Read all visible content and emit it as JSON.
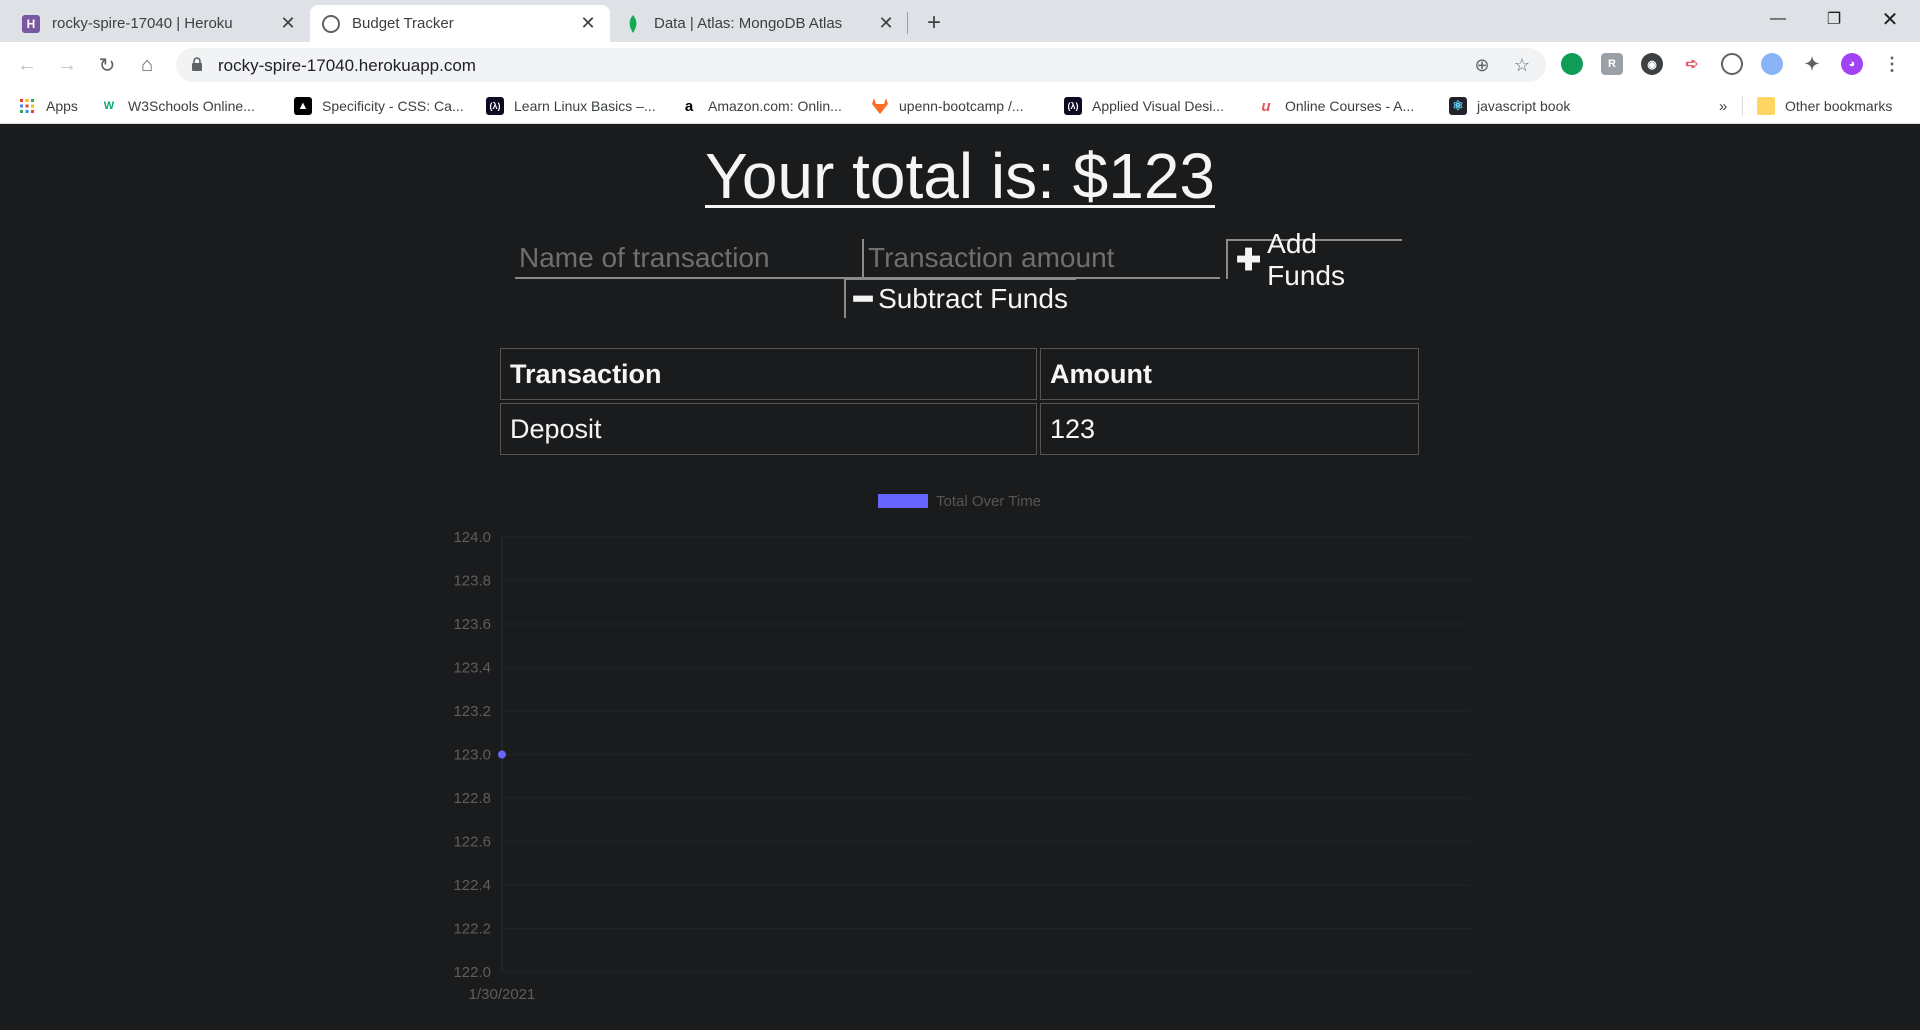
{
  "browser": {
    "tabs": [
      {
        "title": "rocky-spire-17040 | Heroku",
        "active": false,
        "favicon": "heroku-icon"
      },
      {
        "title": "Budget Tracker",
        "active": true,
        "favicon": "budget-icon"
      },
      {
        "title": "Data | Atlas: MongoDB Atlas",
        "active": false,
        "favicon": "mongodb-leaf-icon"
      }
    ],
    "url": "rocky-spire-17040.herokuapp.com",
    "bookmarks": [
      {
        "label": "Apps",
        "icon": "apps-grid-icon"
      },
      {
        "label": "W3Schools Online...",
        "icon": "w3schools-icon"
      },
      {
        "label": "Specificity - CSS: Ca...",
        "icon": "mdn-icon"
      },
      {
        "label": "Learn Linux Basics –...",
        "icon": "fcc-icon"
      },
      {
        "label": "Amazon.com: Onlin...",
        "icon": "amazon-icon"
      },
      {
        "label": "upenn-bootcamp /...",
        "icon": "gitlab-icon"
      },
      {
        "label": "Applied Visual Desi...",
        "icon": "fcc-icon"
      },
      {
        "label": "Online Courses - A...",
        "icon": "udemy-icon"
      },
      {
        "label": "javascript book",
        "icon": "react-icon"
      }
    ],
    "overflow": "»",
    "other_bookmarks": "Other bookmarks"
  },
  "app": {
    "total_text": "Your total is: $123",
    "name_placeholder": "Name of transaction",
    "amount_placeholder": "Transaction amount",
    "add_label": "Add Funds",
    "subtract_label": "Subtract Funds",
    "table": {
      "headers": [
        "Transaction",
        "Amount"
      ],
      "rows": [
        [
          "Deposit",
          "123"
        ]
      ]
    },
    "accent_color": "#6666ff"
  },
  "chart_data": {
    "type": "line",
    "x": [
      "1/30/2021"
    ],
    "series": [
      {
        "name": "Total Over Time",
        "values": [
          123
        ],
        "color": "#6666ff"
      }
    ],
    "ylim": [
      122,
      124
    ],
    "yticks": [
      "124.0",
      "123.8",
      "123.6",
      "123.4",
      "123.2",
      "123.0",
      "122.8",
      "122.6",
      "122.4",
      "122.2",
      "122.0"
    ],
    "legend": "top",
    "grid": true
  }
}
